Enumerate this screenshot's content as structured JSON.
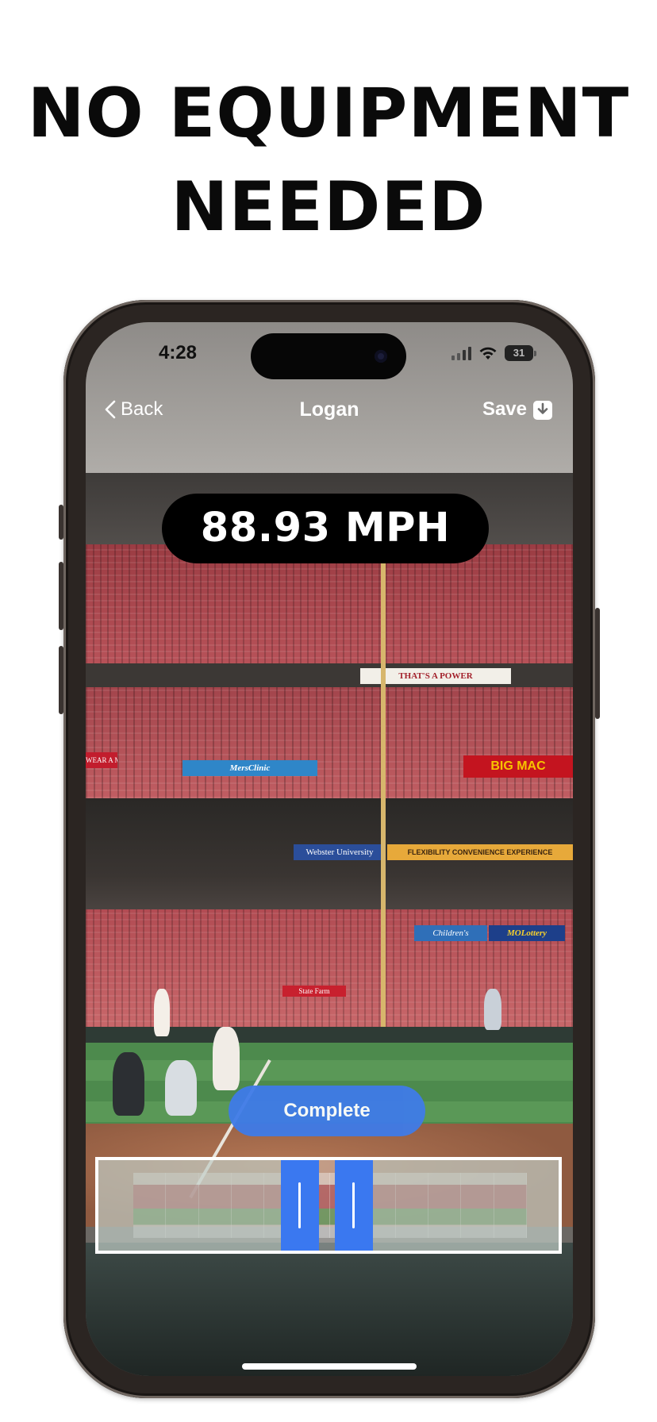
{
  "headline": {
    "line1": "NO EQUIPMENT",
    "line2": "NEEDED"
  },
  "status_bar": {
    "time": "4:28",
    "battery": "31"
  },
  "nav": {
    "back_label": "Back",
    "title": "Logan",
    "save_label": "Save"
  },
  "speed": {
    "value": "88.93 MPH"
  },
  "complete_button": {
    "label": "Complete"
  },
  "scene_text": {
    "banner_power": "THAT'S A POWER",
    "banner_mersclinic": "MersClinic",
    "banner_bigmac": "BIG MAC",
    "banner_webster": "Webster University",
    "banner_flex": "FLEXIBILITY  CONVENIENCE  EXPERIENCE",
    "banner_children": "Children's",
    "banner_molottery": "MOLottery",
    "banner_wear": "WEAR A MASK",
    "banner_statefarm": "State Farm"
  },
  "colors": {
    "accent": "#3f7be8",
    "handle": "#3a78f0",
    "pill": "#000000"
  },
  "icons": [
    "chevron-left-icon",
    "save-download-icon",
    "wifi-icon",
    "signal-icon",
    "battery-icon"
  ]
}
